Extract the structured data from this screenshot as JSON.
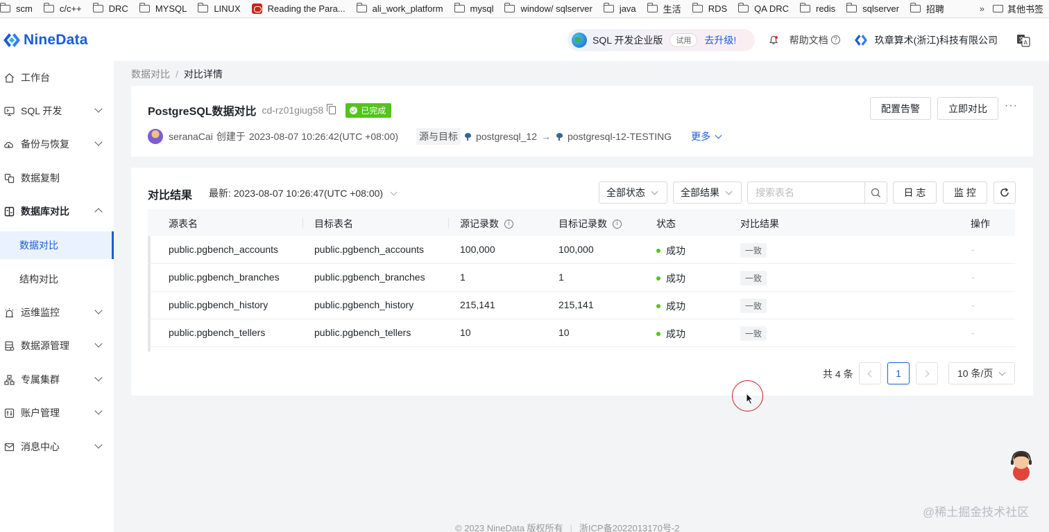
{
  "bookmarks": {
    "items": [
      {
        "label": "scm",
        "icon": "folder-icon"
      },
      {
        "label": "c/c++",
        "icon": "folder-icon"
      },
      {
        "label": "DRC",
        "icon": "folder-icon"
      },
      {
        "label": "MYSQL",
        "icon": "folder-icon"
      },
      {
        "label": "LINUX",
        "icon": "folder-icon"
      },
      {
        "label": "Reading the Para...",
        "icon": "oracle-icon"
      },
      {
        "label": "ali_work_platform",
        "icon": "folder-icon"
      },
      {
        "label": "mysql",
        "icon": "folder-icon"
      },
      {
        "label": "window/ sqlserver",
        "icon": "folder-icon"
      },
      {
        "label": "java",
        "icon": "folder-icon"
      },
      {
        "label": "生活",
        "icon": "folder-icon"
      },
      {
        "label": "RDS",
        "icon": "folder-icon"
      },
      {
        "label": "QA DRC",
        "icon": "folder-icon"
      },
      {
        "label": "redis",
        "icon": "folder-icon"
      },
      {
        "label": "sqlserver",
        "icon": "folder-icon"
      },
      {
        "label": "招聘",
        "icon": "folder-icon"
      }
    ],
    "more": "»",
    "other": "其他书签"
  },
  "header": {
    "logo": "NineData",
    "upgrade_text": "SQL 开发企业版",
    "trial": "试用",
    "upgrade_link": "去升级!",
    "help": "帮助文档",
    "help_mark": "?",
    "company": "玖章算术(浙江)科技有限公司"
  },
  "sidebar": {
    "items": [
      {
        "label": "工作台",
        "icon": "home-icon"
      },
      {
        "label": "SQL 开发",
        "icon": "sql-icon"
      },
      {
        "label": "备份与恢复",
        "icon": "cloud-icon"
      },
      {
        "label": "数据复制",
        "icon": "copy-data-icon"
      },
      {
        "label": "数据库对比",
        "icon": "compare-icon"
      },
      {
        "label": "数据对比"
      },
      {
        "label": "结构对比"
      },
      {
        "label": "运维监控",
        "icon": "monitor-icon"
      },
      {
        "label": "数据源管理",
        "icon": "datasource-icon"
      },
      {
        "label": "专属集群",
        "icon": "cluster-icon"
      },
      {
        "label": "账户管理",
        "icon": "account-icon"
      },
      {
        "label": "消息中心",
        "icon": "mail-icon"
      }
    ]
  },
  "breadcrumb": {
    "parent": "数据对比",
    "sep": "/",
    "current": "对比详情"
  },
  "task": {
    "name": "PostgreSQL数据对比",
    "id": "cd-rz01giug58",
    "status": "已完成",
    "alert_button": "配置告警",
    "compare_button": "立即对比",
    "more_dots": "···",
    "creator": "seranaCai",
    "created_label": "创建于",
    "created_at": "2023-08-07 10:26:42(UTC +08:00)",
    "src_tgt_label": "源与目标",
    "source": "postgresql_12",
    "arrow": "→",
    "target": "postgresql-12-TESTING",
    "more": "更多"
  },
  "results": {
    "title": "对比结果",
    "latest_label": "最新:",
    "latest_time": "2023-08-07 10:26:47(UTC +08:00)",
    "filter_status": "全部状态",
    "filter_result": "全部结果",
    "search_placeholder": "搜索表名",
    "log_button": "日 志",
    "monitor_button": "监 控",
    "columns": [
      "源表名",
      "目标表名",
      "源记录数",
      "目标记录数",
      "状态",
      "对比结果",
      "操作"
    ],
    "info_mark": "i",
    "rows": [
      {
        "source": "public.pgbench_accounts",
        "target": "public.pgbench_accounts",
        "src_count": "100,000",
        "tgt_count": "100,000",
        "status": "成功",
        "result": "一致",
        "action": "-"
      },
      {
        "source": "public.pgbench_branches",
        "target": "public.pgbench_branches",
        "src_count": "1",
        "tgt_count": "1",
        "status": "成功",
        "result": "一致",
        "action": "-"
      },
      {
        "source": "public.pgbench_history",
        "target": "public.pgbench_history",
        "src_count": "215,141",
        "tgt_count": "215,141",
        "status": "成功",
        "result": "一致",
        "action": "-"
      },
      {
        "source": "public.pgbench_tellers",
        "target": "public.pgbench_tellers",
        "src_count": "10",
        "tgt_count": "10",
        "status": "成功",
        "result": "一致",
        "action": "-"
      }
    ],
    "total": "共 4 条",
    "page": "1",
    "page_size": "10 条/页"
  },
  "footer": {
    "copyright": "© 2023 NineData 版权所有",
    "icp": "浙ICP备2022013170号-2"
  },
  "watermark": "@稀土掘金技术社区",
  "colors": {
    "primary": "#1b5cd6",
    "success": "#52c41a",
    "cursor_ring": "#c92a2a"
  }
}
